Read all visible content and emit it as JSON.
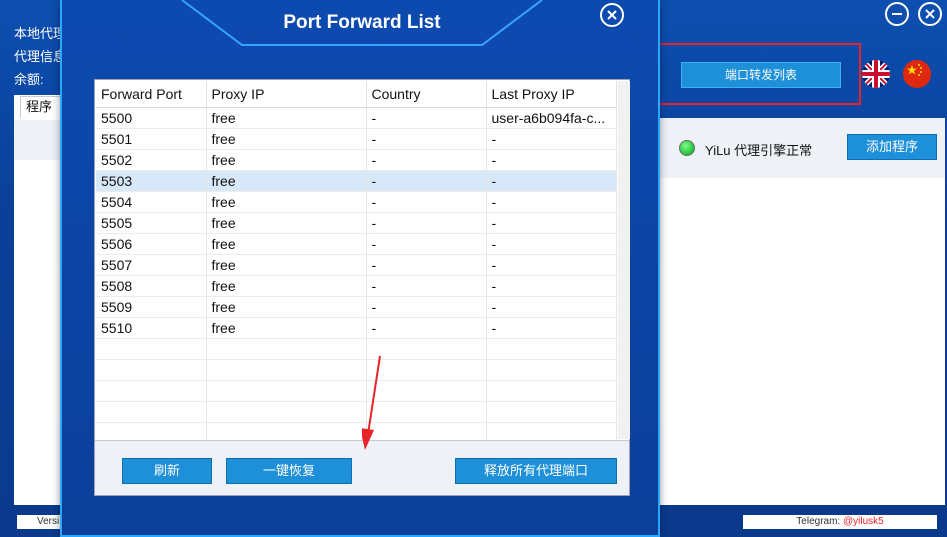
{
  "background": {
    "left_info": [
      "本地代理",
      "代理信息",
      "余额:"
    ],
    "left_tab_label": "程序",
    "port_forward_button": "端口转发列表",
    "status_text": "YiLu 代理引擎正常",
    "add_program_button": "添加程序",
    "version_label": "Versi",
    "telegram_label": "Telegram: ",
    "telegram_handle": "@yilusk5"
  },
  "modal": {
    "title": "Port Forward List",
    "columns": [
      "Forward Port",
      "Proxy IP",
      "Country",
      "Last Proxy IP"
    ],
    "rows": [
      {
        "port": "5500",
        "proxy_ip": "free",
        "country": "-",
        "last_proxy_ip": "user-a6b094fa-c..."
      },
      {
        "port": "5501",
        "proxy_ip": "free",
        "country": "-",
        "last_proxy_ip": "-"
      },
      {
        "port": "5502",
        "proxy_ip": "free",
        "country": "-",
        "last_proxy_ip": "-"
      },
      {
        "port": "5503",
        "proxy_ip": "free",
        "country": "-",
        "last_proxy_ip": "-"
      },
      {
        "port": "5504",
        "proxy_ip": "free",
        "country": "-",
        "last_proxy_ip": "-"
      },
      {
        "port": "5505",
        "proxy_ip": "free",
        "country": "-",
        "last_proxy_ip": "-"
      },
      {
        "port": "5506",
        "proxy_ip": "free",
        "country": "-",
        "last_proxy_ip": "-"
      },
      {
        "port": "5507",
        "proxy_ip": "free",
        "country": "-",
        "last_proxy_ip": "-"
      },
      {
        "port": "5508",
        "proxy_ip": "free",
        "country": "-",
        "last_proxy_ip": "-"
      },
      {
        "port": "5509",
        "proxy_ip": "free",
        "country": "-",
        "last_proxy_ip": "-"
      },
      {
        "port": "5510",
        "proxy_ip": "free",
        "country": "-",
        "last_proxy_ip": "-"
      }
    ],
    "selected_row_index": 3,
    "buttons": {
      "refresh": "刷新",
      "one_click_restore": "一键恢复",
      "release_all": "释放所有代理端口"
    }
  },
  "colors": {
    "accent_blue": "#1e8fd9",
    "highlight_red": "#e8232a",
    "status_green": "#1fbf3a",
    "selected_row": "#d7e8f9"
  }
}
